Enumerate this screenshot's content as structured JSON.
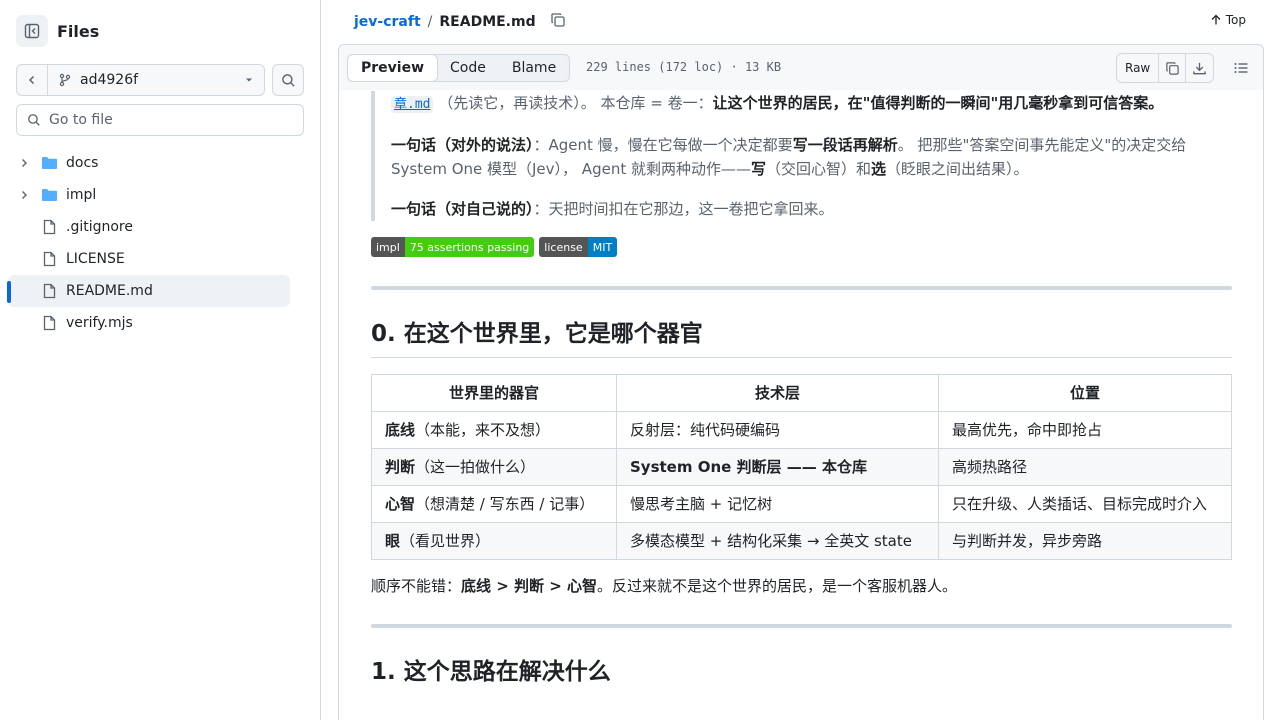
{
  "sidebar": {
    "title": "Files",
    "branch": "ad4926f",
    "goto_placeholder": "Go to file",
    "items": [
      {
        "label": "docs",
        "type": "folder"
      },
      {
        "label": "impl",
        "type": "folder"
      },
      {
        "label": ".gitignore",
        "type": "file"
      },
      {
        "label": "LICENSE",
        "type": "file"
      },
      {
        "label": "README.md",
        "type": "file",
        "selected": true
      },
      {
        "label": "verify.mjs",
        "type": "file"
      }
    ]
  },
  "breadcrumb": {
    "repo": "jev-craft",
    "sep": "/",
    "file": "README.md"
  },
  "top_link": "Top",
  "file_header": {
    "tabs": [
      "Preview",
      "Code",
      "Blame"
    ],
    "active_tab": "Preview",
    "meta": "229 lines (172 loc) · 13 KB",
    "raw_label": "Raw"
  },
  "readme": {
    "intro_link": "章.md",
    "intro_rest": "（先读它，再读技术）。 本仓库 = 卷一：",
    "intro_bold": "让这个世界的居民，在\"值得判断的一瞬间\"用几毫秒拿到可信答案。",
    "p2_bold1": "一句话（对外的说法）",
    "p2_t1": "：Agent 慢，慢在它每做一个决定都要",
    "p2_bold2": "写一段话再解析",
    "p2_t2": "。 把那些\"答案空间事先能定义\"的决定交给 System One 模型（Jev）， Agent 就剩两种动作——",
    "p2_bold3": "写",
    "p2_t3": "（交回心智）和",
    "p2_bold4": "选",
    "p2_t4": "（眨眼之间出结果）。",
    "p3_bold": "一句话（对自己说的）",
    "p3_t": "：天把时间扣在它那边，这一卷把它拿回来。",
    "badges": [
      {
        "left": "impl",
        "right": "75 assertions passing",
        "color": "#44cc11"
      },
      {
        "left": "license",
        "right": "MIT",
        "color": "#007ec6"
      }
    ],
    "h2_0": "0. 在这个世界里，它是哪个器官",
    "table": {
      "headers": [
        "世界里的器官",
        "技术层",
        "位置"
      ],
      "rows": [
        {
          "c1_bold": "底线",
          "c1": "（本能，来不及想）",
          "c2": "反射层：纯代码硬编码",
          "c2_bold": "",
          "c3": "最高优先，命中即抢占"
        },
        {
          "c1_bold": "判断",
          "c1": "（这一拍做什么）",
          "c2": "",
          "c2_bold": "System One 判断层 —— 本仓库",
          "c3": "高频热路径"
        },
        {
          "c1_bold": "心智",
          "c1": "（想清楚 / 写东西 / 记事）",
          "c2": "慢思考主脑 + 记忆树",
          "c2_bold": "",
          "c3": "只在升级、人类插话、目标完成时介入"
        },
        {
          "c1_bold": "眼",
          "c1": "（看见世界）",
          "c2": "多模态模型 + 结构化采集 → 全英文 state",
          "c2_bold": "",
          "c3": "与判断并发，异步旁路"
        }
      ]
    },
    "order_t1": "顺序不能错：",
    "order_bold": "底线 > 判断 > 心智",
    "order_t2": "。反过来就不是这个世界的居民，是一个客服机器人。",
    "h2_1": "1. 这个思路在解决什么"
  }
}
